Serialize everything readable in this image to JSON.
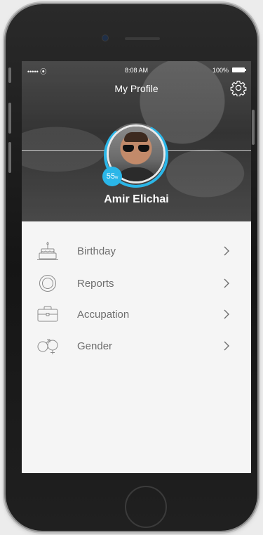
{
  "status_bar": {
    "signal": "••••• ⦿",
    "time": "8:08 AM",
    "battery": "100%"
  },
  "header": {
    "title": "My Profile",
    "settings_icon": "gear-icon"
  },
  "profile": {
    "name": "Amir Elichai",
    "badge_value": "55",
    "badge_unit": "w",
    "ring_color": "#2ab6e8",
    "ring_progress": 0.8
  },
  "menu": {
    "items": [
      {
        "label": "Birthday",
        "icon": "cake-icon"
      },
      {
        "label": "Reports",
        "icon": "reports-icon"
      },
      {
        "label": "Accupation",
        "icon": "briefcase-icon"
      },
      {
        "label": "Gender",
        "icon": "gender-icon"
      }
    ]
  }
}
